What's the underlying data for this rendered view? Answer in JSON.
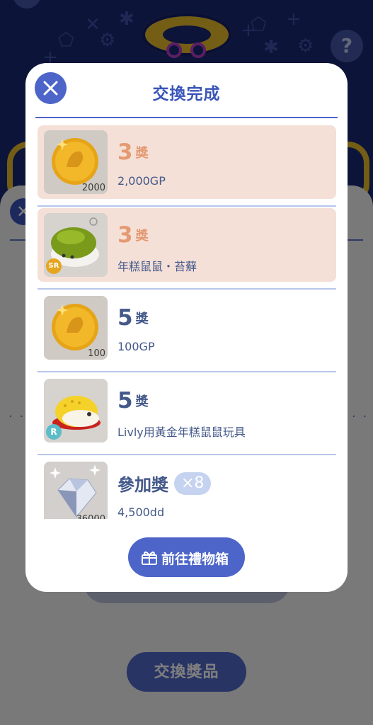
{
  "background": {
    "help_glyph": "?",
    "close_glyph": "✕",
    "dots": "· ·",
    "exchange_button_label": "交換獎品"
  },
  "modal": {
    "title": "交換完成",
    "close_icon": "close-icon",
    "items": [
      {
        "rank": "3",
        "rank_label": "獎",
        "name": "2,000GP",
        "thumb_count": "2000",
        "icon": "gold-coin-icon",
        "highlight": true
      },
      {
        "rank": "3",
        "rank_label": "獎",
        "name": "年糕鼠鼠・苔蘚",
        "rarity": "SR",
        "icon": "moss-mochi-mouse-icon",
        "highlight": true
      },
      {
        "rank": "5",
        "rank_label": "獎",
        "name": "100GP",
        "thumb_count": "100",
        "icon": "gold-coin-icon",
        "highlight": false
      },
      {
        "rank": "5",
        "rank_label": "獎",
        "name": "Livly用黃金年糕鼠鼠玩具",
        "rarity": "R",
        "icon": "golden-mochi-mouse-toy-icon",
        "highlight": false
      },
      {
        "rank": "參加獎",
        "name": "4,500dd",
        "quantity": "×8",
        "thumb_count": "36000",
        "icon": "diamond-icon",
        "highlight": false
      }
    ],
    "gift_button_label": "前往禮物箱",
    "gift_icon": "gift-box-icon"
  },
  "colors": {
    "primary": "#4d65c8",
    "highlight_row": "#f5e0d7",
    "rank_highlight": "#e49a72",
    "text": "#44598a"
  }
}
